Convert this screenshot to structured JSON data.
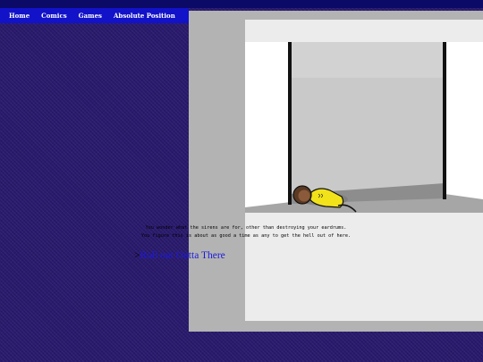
{
  "nav": {
    "items": [
      {
        "label": "Home"
      },
      {
        "label": "Comics"
      },
      {
        "label": "Games"
      },
      {
        "label": "Absolute Position"
      }
    ]
  },
  "story": {
    "line1": "You wonder what the sirens are for, other than destroying your eardrums.",
    "line2": "You figure this is about as good a time as any to get the hell out of here."
  },
  "command": {
    "prompt": ">",
    "link": "Roll out Outta There"
  },
  "colors": {
    "background": "#2a1a6e",
    "nav": "#1212c8",
    "link": "#1a1adc",
    "character_shirt": "#f2e21a"
  }
}
